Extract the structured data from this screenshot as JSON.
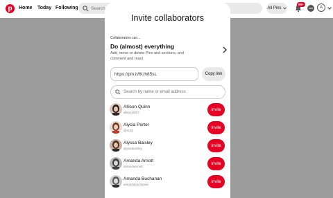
{
  "topbar": {
    "logo_letter": "p",
    "nav": [
      "Home",
      "Today",
      "Following"
    ],
    "search_placeholder": "Search",
    "filter_label": "All Pins",
    "notification_badge": "99+",
    "avatar_letter": "A"
  },
  "modal": {
    "title": "Invite collaborators",
    "section_label": "Collaborators can...",
    "permission_title": "Do (almost) everything",
    "permission_desc": "Add, move or delete Pins and sections, and comment and react",
    "link_value": "https://pin.it/6Uh85sL",
    "copy_label": "Copy link",
    "search_placeholder": "Search by name or email address",
    "invite_label": "Invite",
    "users": [
      {
        "name": "Allison Quinn",
        "handle": "allison0807"
      },
      {
        "name": "Alycia Porter",
        "handle": "@sc43"
      },
      {
        "name": "Alyssa Baisley",
        "handle": "alyssabaisley"
      },
      {
        "name": "Amanda Arnott",
        "handle": "amandaarnott"
      },
      {
        "name": "Amanda Buchanan",
        "handle": "amandabuchanan"
      }
    ]
  },
  "colors": {
    "brand": "#e60023",
    "overlay": "#9c9c9c"
  }
}
